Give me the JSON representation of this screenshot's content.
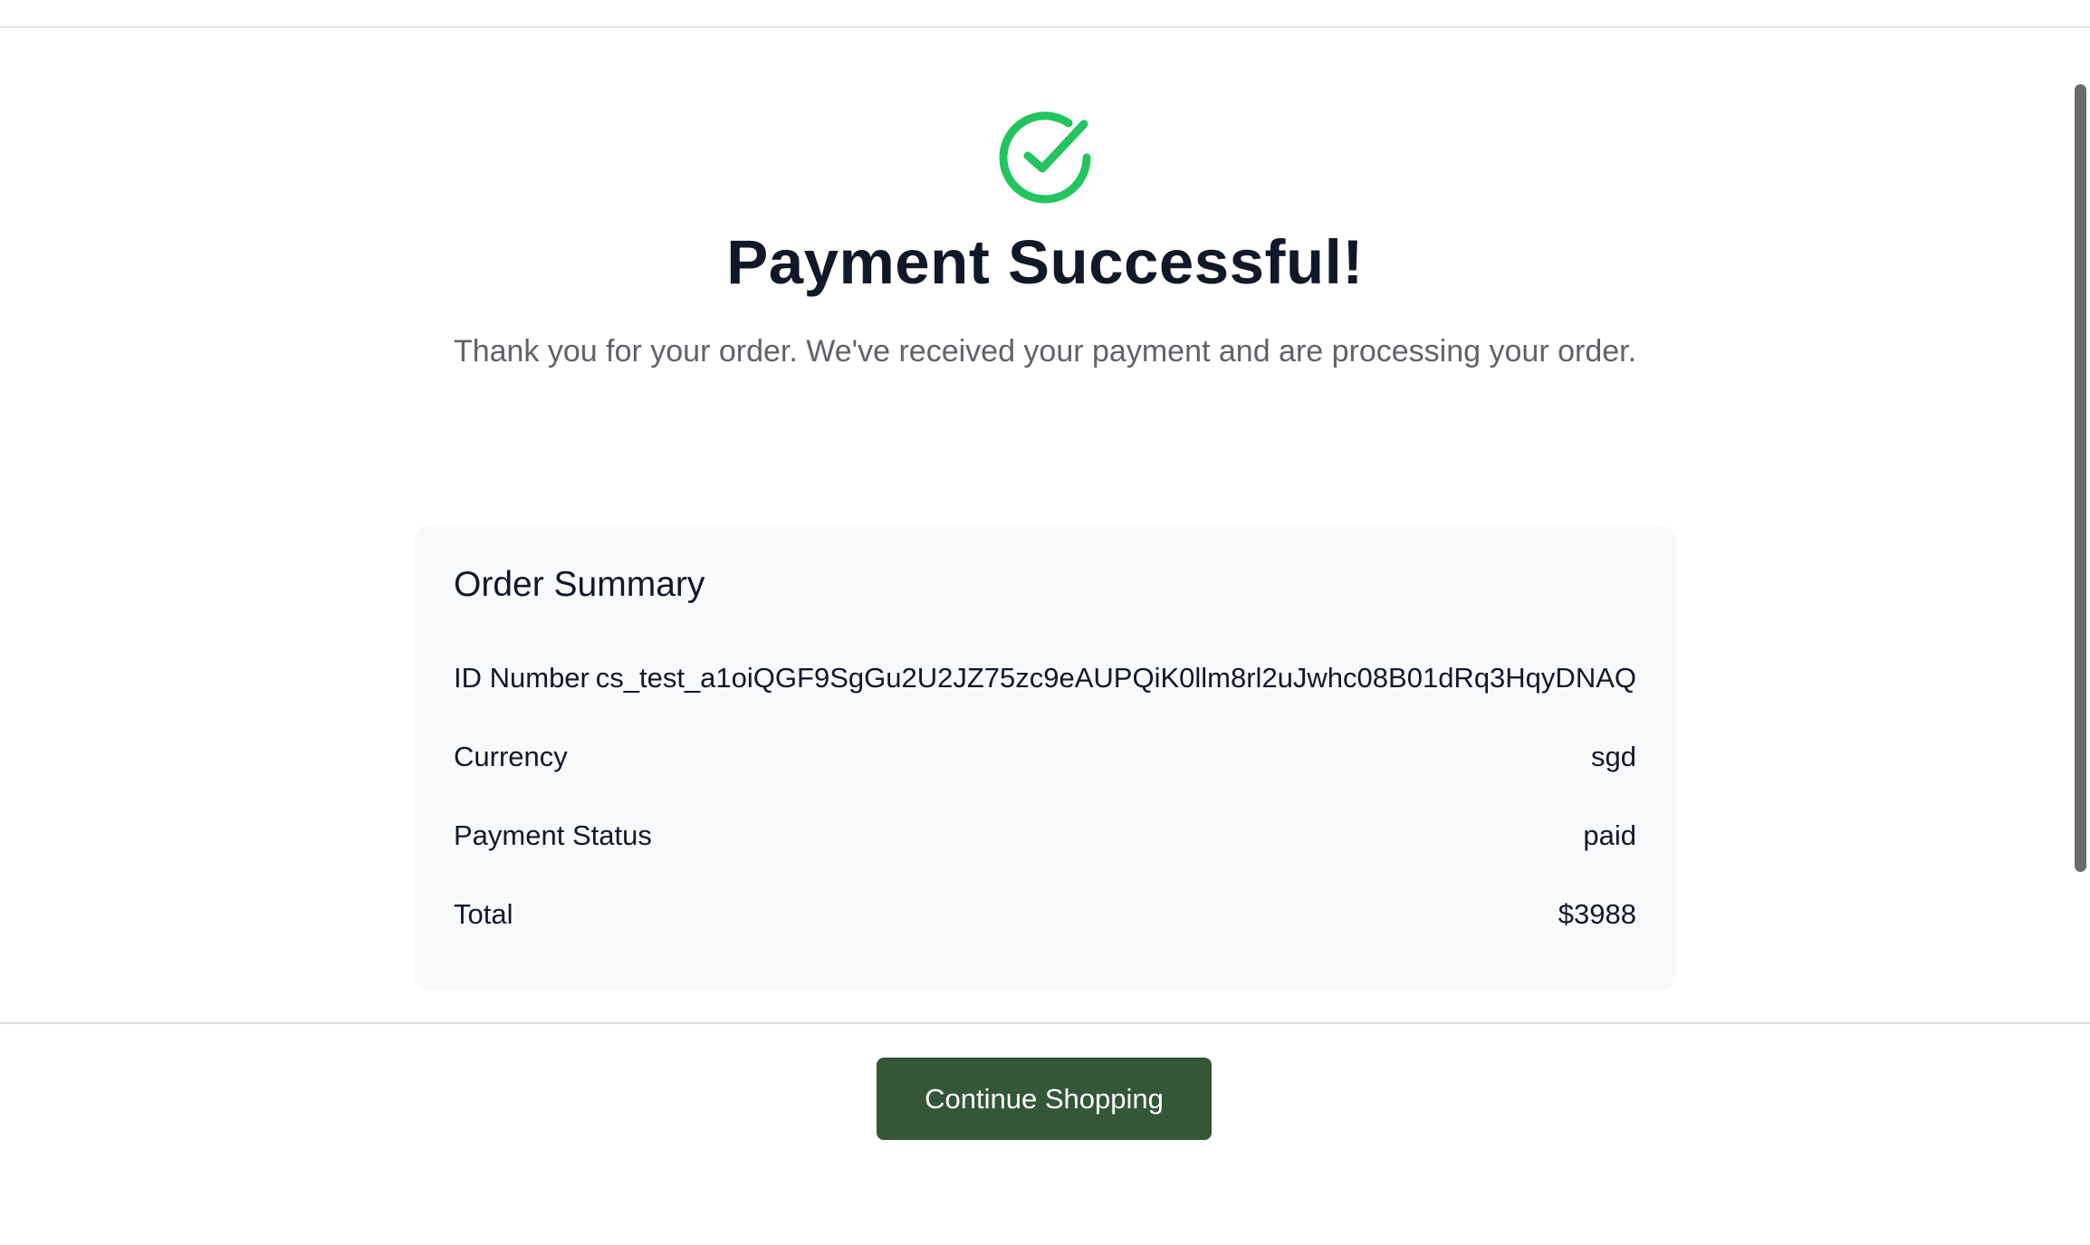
{
  "header": {
    "title": "Payment Successful!",
    "message": "Thank you for your order. We've received your payment and are processing your order."
  },
  "icons": {
    "success": "check-circle-icon"
  },
  "colors": {
    "success_green": "#22c55e",
    "button_bg": "#365638",
    "card_bg": "#f8f9fb"
  },
  "order_summary": {
    "title": "Order Summary",
    "rows": [
      {
        "label": "ID Number",
        "value": "cs_test_a1oiQGF9SgGu2U2JZ75zc9eAUPQiK0llm8rl2uJwhc08B01dRq3HqyDNAQ"
      },
      {
        "label": "Currency",
        "value": "sgd"
      },
      {
        "label": "Payment Status",
        "value": "paid"
      },
      {
        "label": "Total",
        "value": "$3988"
      }
    ]
  },
  "actions": {
    "continue_label": "Continue Shopping"
  }
}
